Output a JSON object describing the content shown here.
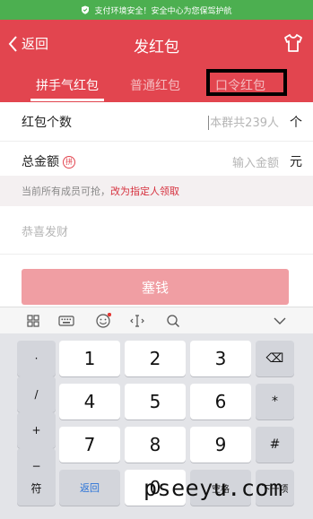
{
  "security_bar": {
    "text": "支付环境安全！安全中心为您保驾护航",
    "color": "#4caf50"
  },
  "header": {
    "back_label": "返回",
    "title": "发红包",
    "shirt_icon": "shirt-icon",
    "background": "#e2454f"
  },
  "tabs": [
    {
      "label": "拼手气红包",
      "active": true
    },
    {
      "label": "普通红包",
      "active": false
    },
    {
      "label": "口令红包",
      "active": false
    }
  ],
  "form": {
    "count_label": "红包个数",
    "count_placeholder": "本群共239人",
    "count_unit": "个",
    "amount_label": "总金额",
    "amount_badge": "拼",
    "amount_placeholder": "输入金额",
    "amount_unit": "元",
    "note_text": "当前所有成员可抢，",
    "note_link": "改为指定人领取",
    "greeting_placeholder": "恭喜发财",
    "send_label": "塞钱"
  },
  "keyboard": {
    "toolbar_icons": [
      "grid-icon",
      "keyboard-icon",
      "emoji-icon",
      "cursor-icon",
      "search-icon",
      "chevron-down-icon"
    ],
    "side_keys": [
      "·",
      "/",
      "+",
      "−"
    ],
    "digits": [
      "1",
      "2",
      "3",
      "4",
      "5",
      "6",
      "7",
      "8",
      "9",
      "0"
    ],
    "right_keys": {
      "delete": "⌫",
      "star": "*",
      "hash": "#",
      "next": "下一项"
    },
    "bottom": {
      "symbols": "符",
      "back": "返回",
      "space": "空格"
    }
  },
  "watermark": "pseeyu.com"
}
